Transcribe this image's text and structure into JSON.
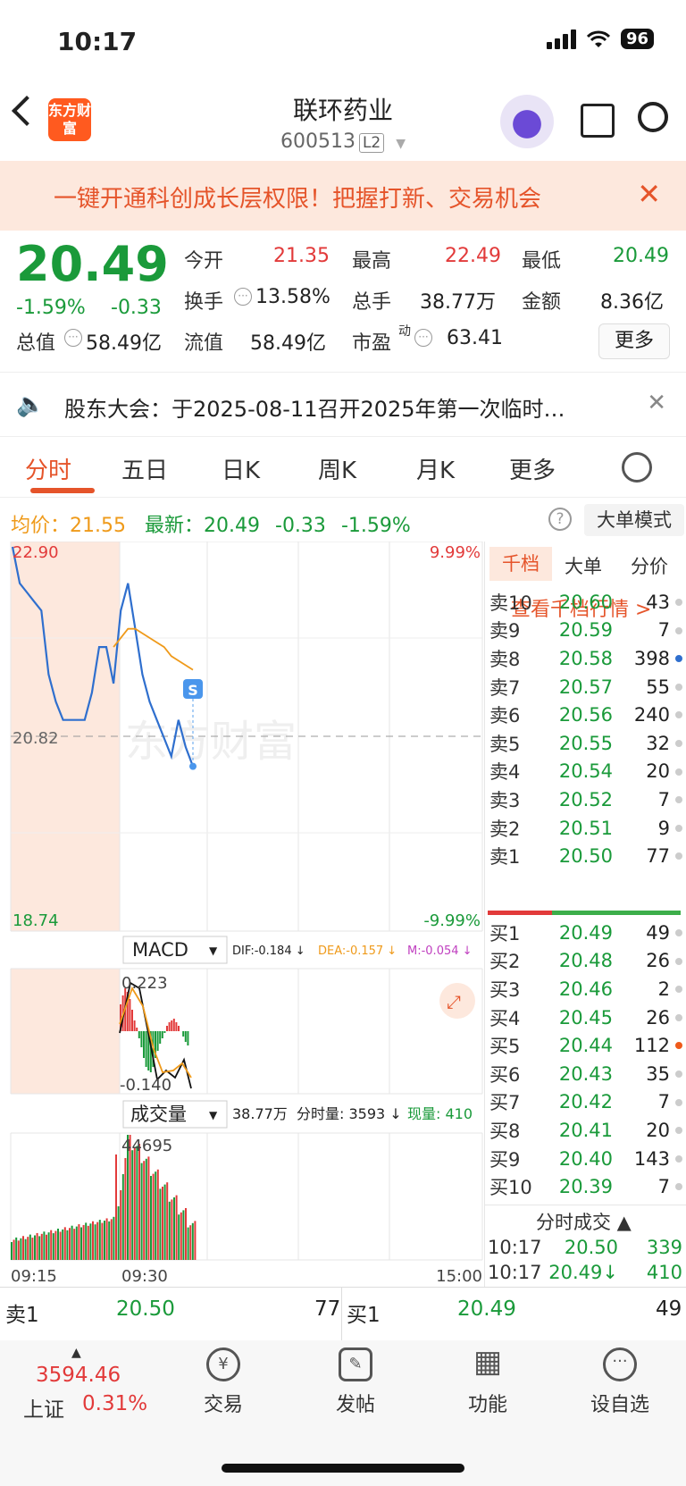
{
  "status": {
    "time": "10:17",
    "battery": "96"
  },
  "header": {
    "logo": "东方财富",
    "name": "联环药业",
    "code": "600513",
    "level": "L2"
  },
  "banner": {
    "text": "一键开通科创成长层权限！把握打新、交易机会",
    "close": "✕"
  },
  "quote": {
    "price": "20.49",
    "pct": "-1.59%",
    "change": "-0.33",
    "open_label": "今开",
    "open": "21.35",
    "high_label": "最高",
    "high": "22.49",
    "low_label": "最低",
    "low": "20.49",
    "turnover_label": "换手",
    "turnover": "13.58%",
    "volume_label": "总手",
    "volume": "38.77万",
    "amount_label": "金额",
    "amount": "8.36亿",
    "mktcap_label": "总值",
    "mktcap": "58.49亿",
    "float_label": "流值",
    "float": "58.49亿",
    "pe_label": "市盈",
    "pe_sup": "动",
    "pe": "63.41",
    "more": "更多"
  },
  "notice": {
    "text": "股东大会：于2025-08-11召开2025年第一次临时…",
    "close": "✕"
  },
  "tabs": [
    "分时",
    "五日",
    "日K",
    "周K",
    "月K",
    "更多"
  ],
  "summary": {
    "avg_label": "均价：",
    "avg": "21.55",
    "last_label": "最新：",
    "last": "20.49",
    "chg": "-0.33",
    "pct": "-1.59%",
    "help": "?",
    "mode": "大单模式"
  },
  "chart_data": {
    "type": "line",
    "title": "",
    "ylim": [
      18.74,
      22.9
    ],
    "y_top": "22.90",
    "y_mid": "20.82",
    "y_bot": "18.74",
    "pct_top": "9.99%",
    "pct_bot": "-9.99%",
    "x_ticks": [
      "09:15",
      "09:30",
      "15:00"
    ],
    "series": [
      {
        "name": "price",
        "values": [
          22.9,
          22.5,
          22.4,
          22.3,
          22.2,
          21.5,
          21.2,
          21.0,
          21.0,
          21.0,
          21.0,
          21.3,
          21.8,
          21.8,
          21.4,
          22.2,
          22.5,
          22.0,
          21.5,
          21.2,
          21.0,
          20.8,
          20.6,
          21.0,
          20.7,
          20.49
        ]
      },
      {
        "name": "avg",
        "values": [
          null,
          null,
          null,
          null,
          null,
          null,
          null,
          null,
          null,
          null,
          null,
          null,
          null,
          null,
          21.8,
          21.9,
          22.0,
          22.0,
          21.95,
          21.9,
          21.85,
          21.8,
          21.7,
          21.65,
          21.6,
          21.55
        ]
      }
    ],
    "marker": "S",
    "macd": {
      "label": "MACD",
      "dif": "DIF:-0.184 ↓",
      "dea": "DEA:-0.157 ↓",
      "m": "M:-0.054 ↓",
      "top": "0.223",
      "bot": "-0.140"
    },
    "vol": {
      "label": "成交量",
      "total": "38.77万",
      "fen": "分时量: 3593 ↓",
      "now": "现量: 410",
      "max": "44695"
    },
    "watermark": "东方财富"
  },
  "orderbook": {
    "tabs": [
      "千档",
      "大单",
      "分价"
    ],
    "link": "查看千档行情 >",
    "asks": [
      {
        "label": "卖10",
        "price": "20.60",
        "vol": "43"
      },
      {
        "label": "卖9",
        "price": "20.59",
        "vol": "7"
      },
      {
        "label": "卖8",
        "price": "20.58",
        "vol": "398"
      },
      {
        "label": "卖7",
        "price": "20.57",
        "vol": "55"
      },
      {
        "label": "卖6",
        "price": "20.56",
        "vol": "240"
      },
      {
        "label": "卖5",
        "price": "20.55",
        "vol": "32"
      },
      {
        "label": "卖4",
        "price": "20.54",
        "vol": "20"
      },
      {
        "label": "卖3",
        "price": "20.52",
        "vol": "7"
      },
      {
        "label": "卖2",
        "price": "20.51",
        "vol": "9"
      },
      {
        "label": "卖1",
        "price": "20.50",
        "vol": "77"
      }
    ],
    "bids": [
      {
        "label": "买1",
        "price": "20.49",
        "vol": "49"
      },
      {
        "label": "买2",
        "price": "20.48",
        "vol": "26"
      },
      {
        "label": "买3",
        "price": "20.46",
        "vol": "2"
      },
      {
        "label": "买4",
        "price": "20.45",
        "vol": "26"
      },
      {
        "label": "买5",
        "price": "20.44",
        "vol": "112"
      },
      {
        "label": "买6",
        "price": "20.43",
        "vol": "35"
      },
      {
        "label": "买7",
        "price": "20.42",
        "vol": "7"
      },
      {
        "label": "买8",
        "price": "20.41",
        "vol": "20"
      },
      {
        "label": "买9",
        "price": "20.40",
        "vol": "143"
      },
      {
        "label": "买10",
        "price": "20.39",
        "vol": "7"
      }
    ],
    "trades_title": "分时成交 ▲",
    "trades": [
      {
        "time": "10:17",
        "price": "20.50",
        "vol": "339"
      },
      {
        "time": "10:17",
        "price": "20.49↓",
        "vol": "410"
      }
    ]
  },
  "bottom_quote": {
    "ask_label": "卖1",
    "ask_price": "20.50",
    "ask_vol": "77",
    "bid_label": "买1",
    "bid_price": "20.49",
    "bid_vol": "49"
  },
  "nav": {
    "index_value": "3594.46",
    "index_name": "上证",
    "index_pct": "0.31%",
    "items": [
      {
        "label": "交易",
        "icon": "¥"
      },
      {
        "label": "发帖",
        "icon": "✎"
      },
      {
        "label": "功能",
        "icon": "▦"
      },
      {
        "label": "设自选",
        "icon": "···"
      }
    ]
  },
  "colors": {
    "accent": "#e5542a",
    "down": "#1a9a3a",
    "up": "#e23a3a",
    "avg": "#ef9a1a",
    "price_line": "#2f6fce"
  }
}
